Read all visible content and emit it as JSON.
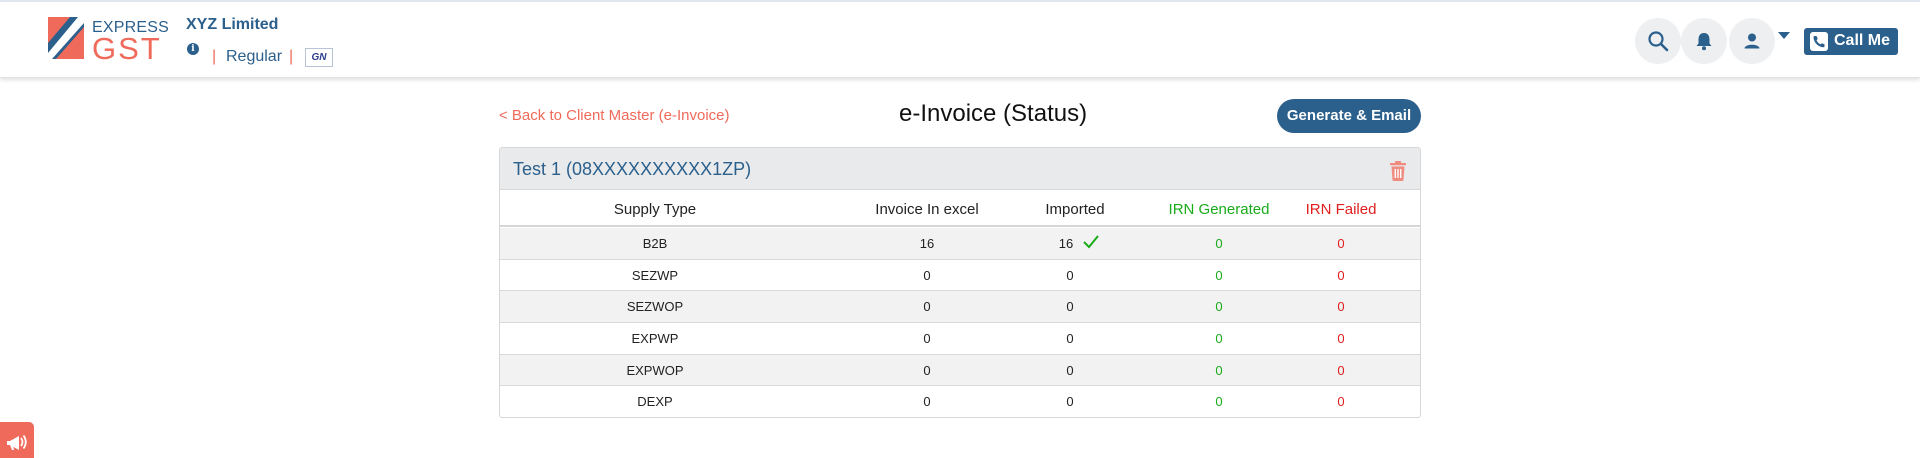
{
  "brand": {
    "express": "EXPRESS",
    "gst": "GST",
    "colors": {
      "primary": "#2b5f8c",
      "accent": "#ef6a5a",
      "success": "#1aab1a",
      "danger": "#e01e1e"
    }
  },
  "header": {
    "company_name": "XYZ Limited",
    "info_icon": "i",
    "separator": "|",
    "registration_type": "Regular",
    "gstn_logo_text": "GN",
    "icons": [
      "search-icon",
      "bell-icon",
      "user-icon",
      "chevron-down-icon",
      "phone-icon"
    ],
    "call_me_label": "Call Me"
  },
  "toolbar": {
    "back_link": "< Back to Client Master (e-Invoice)",
    "title": "e-Invoice (Status)",
    "generate_button": "Generate & Email"
  },
  "card": {
    "title": "Test 1 (08XXXXXXXXXX1ZP)",
    "delete_icon": "trash-icon",
    "columns": [
      "Supply Type",
      "Invoice In excel",
      "Imported",
      "IRN Generated",
      "IRN Failed"
    ],
    "rows": [
      {
        "supply_type": "B2B",
        "invoice_in_excel": "16",
        "imported": "16",
        "imported_check": true,
        "irn_generated": "0",
        "irn_failed": "0"
      },
      {
        "supply_type": "SEZWP",
        "invoice_in_excel": "0",
        "imported": "0",
        "imported_check": false,
        "irn_generated": "0",
        "irn_failed": "0"
      },
      {
        "supply_type": "SEZWOP",
        "invoice_in_excel": "0",
        "imported": "0",
        "imported_check": false,
        "irn_generated": "0",
        "irn_failed": "0"
      },
      {
        "supply_type": "EXPWP",
        "invoice_in_excel": "0",
        "imported": "0",
        "imported_check": false,
        "irn_generated": "0",
        "irn_failed": "0"
      },
      {
        "supply_type": "EXPWOP",
        "invoice_in_excel": "0",
        "imported": "0",
        "imported_check": false,
        "irn_generated": "0",
        "irn_failed": "0"
      },
      {
        "supply_type": "DEXP",
        "invoice_in_excel": "0",
        "imported": "0",
        "imported_check": false,
        "irn_generated": "0",
        "irn_failed": "0"
      }
    ]
  },
  "feedback": {
    "icon": "megaphone-icon"
  }
}
